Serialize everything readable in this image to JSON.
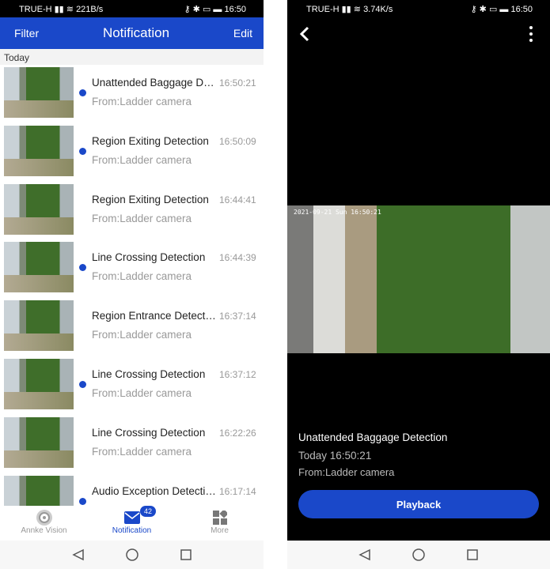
{
  "status_left": {
    "carrier": "TRUE-H",
    "speed": "221B/s",
    "time": "16:50"
  },
  "status_right": {
    "carrier": "TRUE-H",
    "speed": "3.74K/s",
    "time": "16:50"
  },
  "header": {
    "filter": "Filter",
    "title": "Notification",
    "edit": "Edit"
  },
  "section": "Today",
  "notifications": [
    {
      "title": "Unattended Baggage Detection",
      "time": "16:50:21",
      "from": "From:Ladder camera",
      "unread": true
    },
    {
      "title": "Region Exiting Detection",
      "time": "16:50:09",
      "from": "From:Ladder camera",
      "unread": true
    },
    {
      "title": "Region Exiting Detection",
      "time": "16:44:41",
      "from": "From:Ladder camera",
      "unread": false
    },
    {
      "title": "Line Crossing Detection",
      "time": "16:44:39",
      "from": "From:Ladder camera",
      "unread": true
    },
    {
      "title": "Region Entrance Detection",
      "time": "16:37:14",
      "from": "From:Ladder camera",
      "unread": false
    },
    {
      "title": "Line Crossing Detection",
      "time": "16:37:12",
      "from": "From:Ladder camera",
      "unread": true
    },
    {
      "title": "Line Crossing Detection",
      "time": "16:22:26",
      "from": "From:Ladder camera",
      "unread": false
    },
    {
      "title": "Audio Exception Detection",
      "time": "16:17:14",
      "from": "",
      "unread": true
    }
  ],
  "tabs": [
    {
      "label": "Annke Vision",
      "icon": "camera-lens-icon"
    },
    {
      "label": "Notification",
      "icon": "envelope-icon",
      "badge": "42"
    },
    {
      "label": "More",
      "icon": "grid-icon"
    }
  ],
  "detail": {
    "video_timestamp": "2021-09-21 Sun 16:50:21",
    "title": "Unattended Baggage Detection",
    "time": "Today 16:50:21",
    "from": "From:Ladder camera",
    "playback": "Playback"
  },
  "colors": {
    "accent": "#1a48c9"
  }
}
